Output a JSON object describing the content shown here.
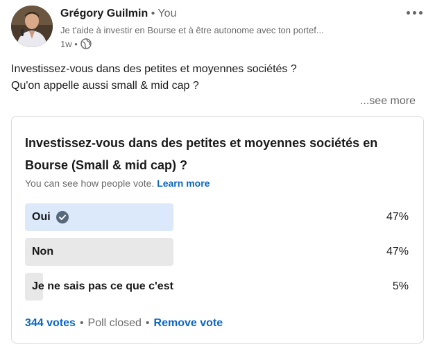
{
  "post": {
    "author": {
      "name": "Grégory Guilmin",
      "you_label": "• You",
      "headline": "Je t'aide à investir en Bourse et à être autonome avec ton portef...",
      "time": "1w •",
      "visibility_icon": "globe-icon"
    },
    "text_lines": [
      "Investissez-vous dans des petites et moyennes sociétés ?",
      "Qu'on appelle aussi small & mid cap ?"
    ],
    "see_more": "...see more",
    "more_menu_icon": "ellipsis-icon"
  },
  "poll": {
    "question": "Investissez-vous dans des petites et moyennes sociétés en Bourse (Small & mid cap) ?",
    "visibility_note": "You can see how people vote.",
    "learn_more": "Learn more",
    "options": [
      {
        "label": "Oui",
        "percent_label": "47%",
        "fraction": 0.47,
        "selected": true
      },
      {
        "label": "Non",
        "percent_label": "47%",
        "fraction": 0.47,
        "selected": false
      },
      {
        "label": "Je ne sais pas ce que c'est",
        "percent_label": "5%",
        "fraction": 0.05,
        "selected": false
      }
    ],
    "votes": "344 votes",
    "separator": "•",
    "status": "Poll closed",
    "remove_vote": "Remove vote"
  },
  "colors": {
    "accent": "#0a66c2",
    "bar_selected": "#dce9fa",
    "bar_default": "#e8e8e8",
    "check": "#56687a"
  }
}
